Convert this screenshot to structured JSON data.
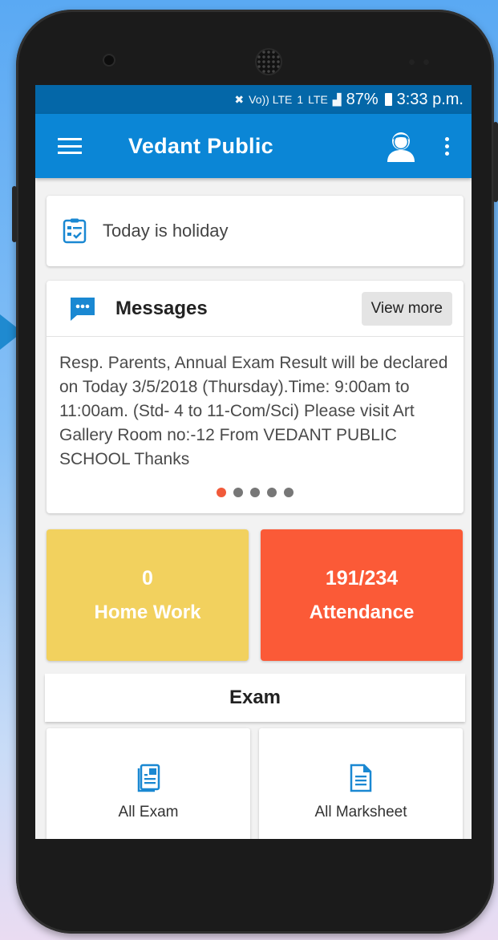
{
  "status_bar": {
    "signal_label": "Vo)) LTE",
    "sim_label": "1",
    "lte_label": "LTE",
    "battery_percent": "87%",
    "time": "3:33 p.m."
  },
  "app_bar": {
    "title": "Vedant Public",
    "menu_icon": "hamburger-menu-icon",
    "profile_icon": "user-avatar-icon",
    "more_icon": "more-vertical-icon"
  },
  "holiday_card": {
    "icon": "checklist-icon",
    "text": "Today is holiday"
  },
  "messages_card": {
    "icon": "chat-bubble-icon",
    "title": "Messages",
    "view_more_label": "View more",
    "body": "Resp. Parents, Annual Exam Result will be declared on Today 3/5/2018 (Thursday).Time: 9:00am to 11:00am. (Std- 4 to 11-Com/Sci) Please visit Art Gallery Room no:-12 From VEDANT PUBLIC SCHOOL Thanks",
    "page_count": 5,
    "active_page": 1
  },
  "tiles": {
    "homework": {
      "value": "0",
      "label": "Home Work"
    },
    "attendance": {
      "value": "191/234",
      "label": "Attendance"
    }
  },
  "exam_section": {
    "title": "Exam",
    "items": [
      {
        "label": "All Exam",
        "icon": "exam-sheet-icon"
      },
      {
        "label": "All Marksheet",
        "icon": "document-icon"
      }
    ]
  },
  "colors": {
    "status_bar": "#0467a8",
    "app_bar": "#0b86d6",
    "accent_icon": "#1a88d2",
    "homework_tile": "#f2d15e",
    "attendance_tile": "#fb5a37",
    "active_dot": "#f15a3a"
  }
}
